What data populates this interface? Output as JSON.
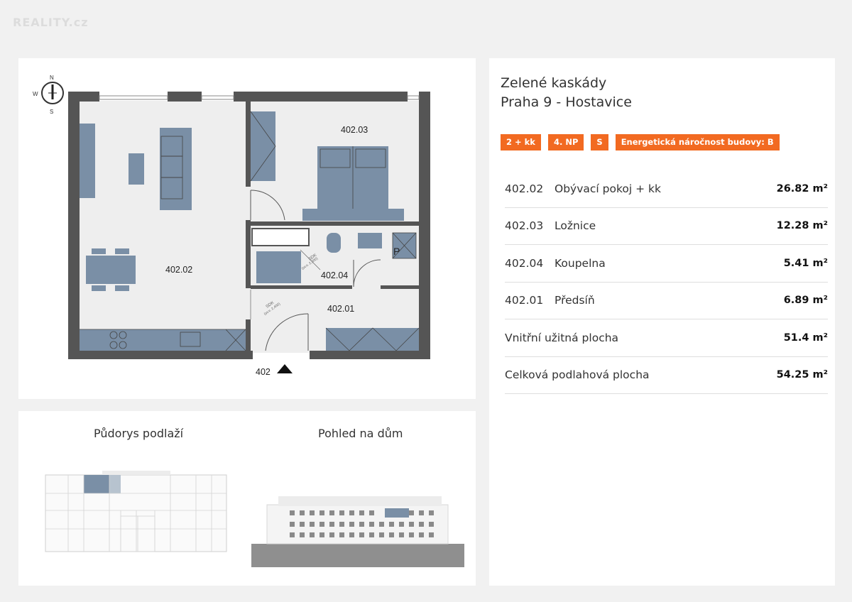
{
  "watermark": "REALITY.cz",
  "plan": {
    "compass": {
      "n": "N",
      "w": "W",
      "s": "S"
    },
    "rooms": {
      "r0203": "402.03",
      "r0202": "402.02",
      "r0204": "402.04",
      "r0201": "402.01"
    },
    "door_label": "SDK",
    "door_sub_1": "(sv.v. 2,300)",
    "door_sub_2": "(sv.v. 2,400)",
    "parking_letter": "P",
    "entrance": "402"
  },
  "mini": {
    "floor_plan_label": "Půdorys podlaží",
    "house_view_label": "Pohled na dům"
  },
  "info": {
    "title_line1": "Zelené kaskády",
    "title_line2": "Praha 9 - Hostavice",
    "tags": [
      "2 + kk",
      "4. NP",
      "S",
      "Energetická náročnost budovy: B"
    ],
    "rooms": [
      {
        "code": "402.02",
        "name": "Obývací pokoj + kk",
        "area": "26.82 m²"
      },
      {
        "code": "402.03",
        "name": "Ložnice",
        "area": "12.28 m²"
      },
      {
        "code": "402.04",
        "name": "Koupelna",
        "area": "5.41 m²"
      },
      {
        "code": "402.01",
        "name": "Předsíň",
        "area": "6.89 m²"
      }
    ],
    "summary": [
      {
        "label": "Vnitřní užitná plocha",
        "area": "51.4 m²"
      },
      {
        "label": "Celková podlahová plocha",
        "area": "54.25 m²"
      }
    ]
  },
  "colors": {
    "accent": "#f26a21",
    "furniture": "#7a8fa6",
    "wall": "#4a4a4a"
  }
}
